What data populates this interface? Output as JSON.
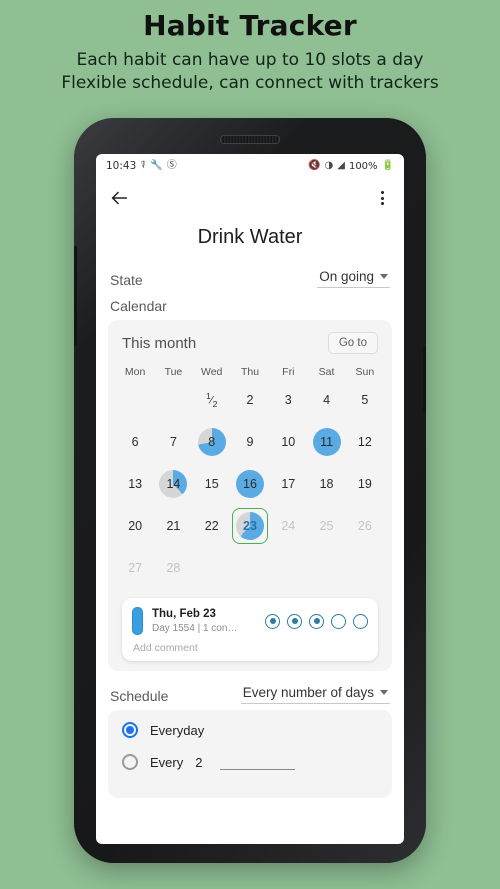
{
  "promo": {
    "title": "Habit Tracker",
    "subtitle_line1": "Each habit can have up to 10 slots a day",
    "subtitle_line2": "Flexible schedule, can connect with trackers",
    "background_color": "#8fbf93"
  },
  "status_bar": {
    "time": "10:43",
    "left_icons": [
      "screenshot-icon",
      "wrench-icon",
      "do-not-disturb-icon"
    ],
    "mute_icon": "×",
    "wifi_icon": "wifi-icon",
    "signal_icon": "signal-icon",
    "battery_percent": "100%",
    "battery_icon": "battery-icon"
  },
  "app_bar": {
    "back_label": "Back",
    "overflow_label": "More options"
  },
  "page": {
    "title": "Drink Water"
  },
  "state_row": {
    "label": "State",
    "value": "On going"
  },
  "calendar_section": {
    "label": "Calendar",
    "card_title": "This month",
    "goto_button": "Go to",
    "weekdays": [
      "Mon",
      "Tue",
      "Wed",
      "Thu",
      "Fri",
      "Sat",
      "Sun"
    ],
    "accent_fill": "#5aabe4",
    "accent_empty": "#d6d6d6",
    "selected_outline": "#4caf50",
    "days": [
      {
        "label": "",
        "blank": true
      },
      {
        "label": "",
        "blank": true
      },
      {
        "label": "1/2",
        "fraction": true,
        "num": "1",
        "den": "2",
        "progress": 0,
        "state": "past"
      },
      {
        "label": "2",
        "progress": 0,
        "state": "past"
      },
      {
        "label": "3",
        "progress": 0,
        "state": "past"
      },
      {
        "label": "4",
        "progress": 0,
        "state": "past"
      },
      {
        "label": "5",
        "progress": 0,
        "state": "past"
      },
      {
        "label": "6",
        "progress": 0,
        "state": "past"
      },
      {
        "label": "7",
        "progress": 0,
        "state": "past"
      },
      {
        "label": "8",
        "progress": 72,
        "state": "past"
      },
      {
        "label": "9",
        "progress": 0,
        "state": "past"
      },
      {
        "label": "10",
        "progress": 0,
        "state": "past"
      },
      {
        "label": "11",
        "progress": 100,
        "state": "past"
      },
      {
        "label": "12",
        "progress": 0,
        "state": "past"
      },
      {
        "label": "13",
        "progress": 0,
        "state": "past"
      },
      {
        "label": "14",
        "progress": 38,
        "state": "past"
      },
      {
        "label": "15",
        "progress": 0,
        "state": "past"
      },
      {
        "label": "16",
        "progress": 100,
        "state": "past"
      },
      {
        "label": "17",
        "progress": 0,
        "state": "past"
      },
      {
        "label": "18",
        "progress": 0,
        "state": "past"
      },
      {
        "label": "19",
        "progress": 0,
        "state": "past"
      },
      {
        "label": "20",
        "progress": 0,
        "state": "past"
      },
      {
        "label": "21",
        "progress": 0,
        "state": "past"
      },
      {
        "label": "22",
        "progress": 0,
        "state": "past"
      },
      {
        "label": "23",
        "progress": 62,
        "state": "selected"
      },
      {
        "label": "24",
        "progress": 0,
        "state": "future"
      },
      {
        "label": "25",
        "progress": 0,
        "state": "future"
      },
      {
        "label": "26",
        "progress": 0,
        "state": "future"
      },
      {
        "label": "27",
        "progress": 0,
        "state": "future"
      },
      {
        "label": "28",
        "progress": 0,
        "state": "future"
      },
      {
        "label": "",
        "blank": true
      },
      {
        "label": "",
        "blank": true
      },
      {
        "label": "",
        "blank": true
      },
      {
        "label": "",
        "blank": true
      },
      {
        "label": "",
        "blank": true
      }
    ]
  },
  "detail_card": {
    "date": "Thu, Feb 23",
    "subtitle": "Day 1554 | 1 con…",
    "slots": [
      true,
      true,
      true,
      false,
      false
    ],
    "slot_color": "#2d7da0",
    "add_comment": "Add comment",
    "marker_color": "#3a9fe0"
  },
  "schedule_section": {
    "label": "Schedule",
    "mode": "Every number of days",
    "options": [
      {
        "label": "Everyday",
        "selected": true
      },
      {
        "label": "Every",
        "selected": false,
        "value": "2"
      }
    ]
  }
}
